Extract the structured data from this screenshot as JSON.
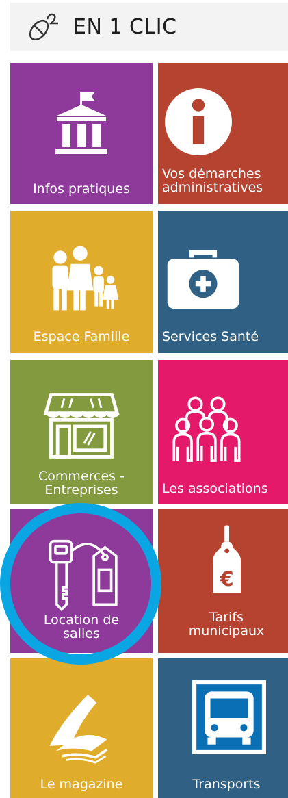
{
  "header": {
    "title": "EN 1 CLIC",
    "icon": "mouse-icon"
  },
  "colors": {
    "purple": "#8d3a9b",
    "rust": "#b6432f",
    "mustard": "#e0ac2c",
    "steel": "#306185",
    "olive": "#839a3f",
    "pink": "#e5196a",
    "ring": "#0aa6e3"
  },
  "tiles": [
    {
      "label": "Infos pratiques",
      "icon": "town-hall-icon"
    },
    {
      "label": "Vos démarches\nadministratives",
      "icon": "info-icon"
    },
    {
      "label": "Espace Famille",
      "icon": "family-icon"
    },
    {
      "label": "Services Santé",
      "icon": "medical-kit-icon"
    },
    {
      "label": "Commerces -\nEntreprises",
      "icon": "shop-icon"
    },
    {
      "label": "Les associations",
      "icon": "people-group-icon"
    },
    {
      "label": "Location de\nsalles",
      "icon": "key-tag-icon"
    },
    {
      "label": "Tarifs\nmunicipaux",
      "icon": "euro-tag-icon"
    },
    {
      "label": "Le magazine",
      "icon": "magazine-icon"
    },
    {
      "label": "Transports",
      "icon": "bus-icon"
    }
  ]
}
